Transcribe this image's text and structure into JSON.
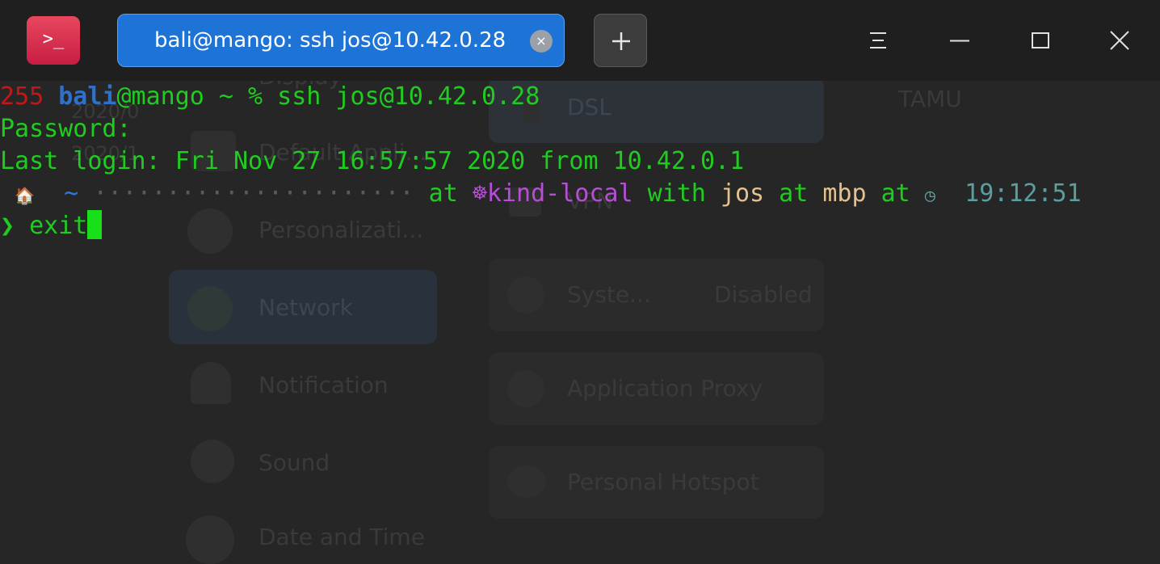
{
  "window": {
    "tab_title": "bali@mango: ssh jos@10.42.0.28",
    "tab_close_glyph": "×",
    "app_icon_glyph": ">_",
    "icons": [
      "terminal-app-icon",
      "tab-close-icon",
      "new-tab-plus-icon",
      "menu-icon",
      "minimize-icon",
      "maximize-icon",
      "close-icon"
    ]
  },
  "background": {
    "items": [
      "Display",
      "Default Appli...",
      "Personalizati...",
      "Network",
      "Notification",
      "Sound",
      "Date and Time"
    ],
    "side_texts": [
      "2020/0",
      "2020/1"
    ],
    "panel": {
      "dsl": "DSL",
      "vpn": "VPN",
      "system_proxy": "Syste...",
      "system_proxy_state": "Disabled",
      "app_proxy": "Application Proxy",
      "hotspot": "Personal Hotspot"
    },
    "tamu": "TAMU"
  },
  "terminal": {
    "l1": {
      "status": "255",
      "user": "bali",
      "host_prompt": "@mango ~ % ssh jos@10.42.0.28"
    },
    "l2": "Password:",
    "l3": "Last login: Fri Nov 27 16:57:57 2020 from 10.42.0.1",
    "l4": {
      "apple": "",
      "home": "🏠",
      "tilde": "~",
      "dots": "······················",
      "at1": "at",
      "k8s_icon": "☸",
      "context": "kind-local",
      "with": "with",
      "user": "jos",
      "at2": "at",
      "host": "mbp",
      "at3": "at",
      "clock": "◷",
      "time": "19:12:51"
    },
    "l5": {
      "chevron": "❯",
      "command": "exit"
    }
  },
  "colors": {
    "prompt_green": "#1fcc1f",
    "status_red": "#c41818",
    "user_blue": "#2f70c8",
    "context_purple": "#b64fd6",
    "tab_blue": "#1e74d6"
  }
}
